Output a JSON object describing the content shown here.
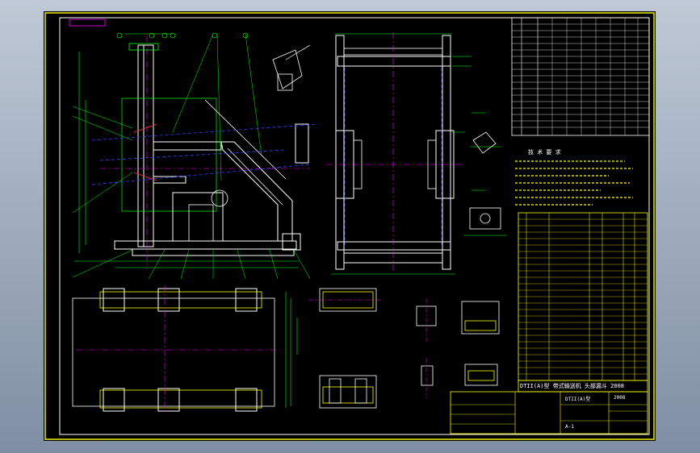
{
  "drawing": {
    "title_line": "DTII(A)型  带式输送机 头部漏斗 2008",
    "year": "2008",
    "drawing_no": "DTII(A)型",
    "tech_req_heading": "技  术  要  求",
    "sheet_code": "A-1",
    "colors": {
      "frame": "#ffff00",
      "border": "#ffffff",
      "steel": "#ffffff",
      "dims": "#00ff00",
      "centerline": "#ff00ff",
      "hidden": "#3344ff",
      "background": "#000000"
    }
  }
}
